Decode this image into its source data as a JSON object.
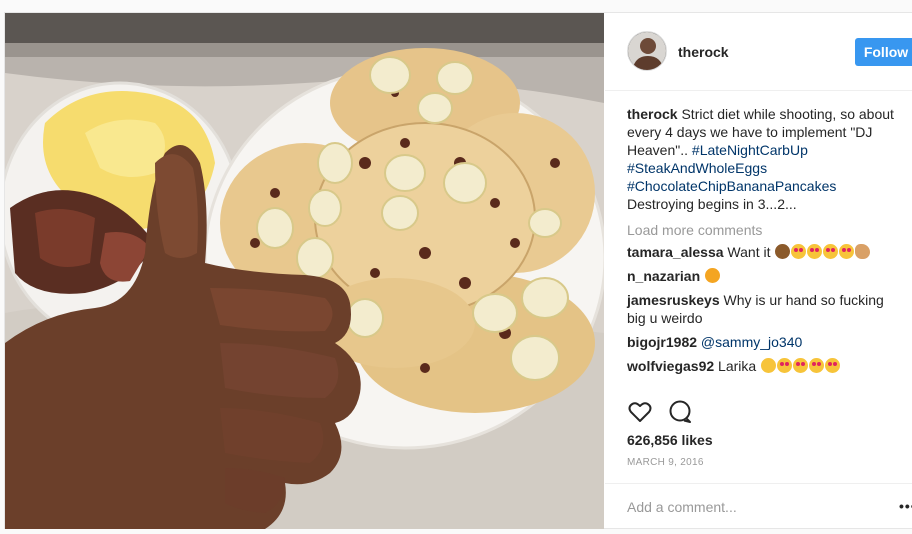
{
  "post": {
    "username": "therock",
    "follow_label": "Follow",
    "caption": {
      "username": "therock",
      "text": "Strict diet while shooting, so about every 4 days we have to implement \"DJ Heaven\"..",
      "hashtags": [
        "#LateNightCarbUp",
        "#SteakAndWholeEggs",
        "#ChocolateChipBananaPancakes"
      ],
      "closing": "Destroying begins in 3...2..."
    },
    "load_more_label": "Load more comments",
    "comments": [
      {
        "username": "tamara_alessa",
        "text": "Want it",
        "emojis": [
          "monkey",
          "heart",
          "heart",
          "heart",
          "heart",
          "muscle"
        ]
      },
      {
        "username": "n_nazarian",
        "text": "",
        "emojis": [
          "cat"
        ]
      },
      {
        "username": "jamesruskeys",
        "text": "Why is ur hand so fucking big u weirdo",
        "emojis": []
      },
      {
        "username": "bigojr1982",
        "mention": "@sammy_jo340",
        "emojis": []
      },
      {
        "username": "wolfviegas92",
        "text": "Larika",
        "emojis": [
          "yum",
          "heart",
          "heart",
          "heart",
          "heart"
        ]
      }
    ],
    "likes": "626,856 likes",
    "date": "MARCH 9, 2016",
    "add_comment_placeholder": "Add a comment...",
    "more_label": "•••",
    "icons": {
      "like": "heart-outline-icon",
      "comment": "speech-bubble-icon"
    },
    "colors": {
      "follow_button": "#3897f0",
      "link": "#003569",
      "muted": "#999999"
    }
  }
}
